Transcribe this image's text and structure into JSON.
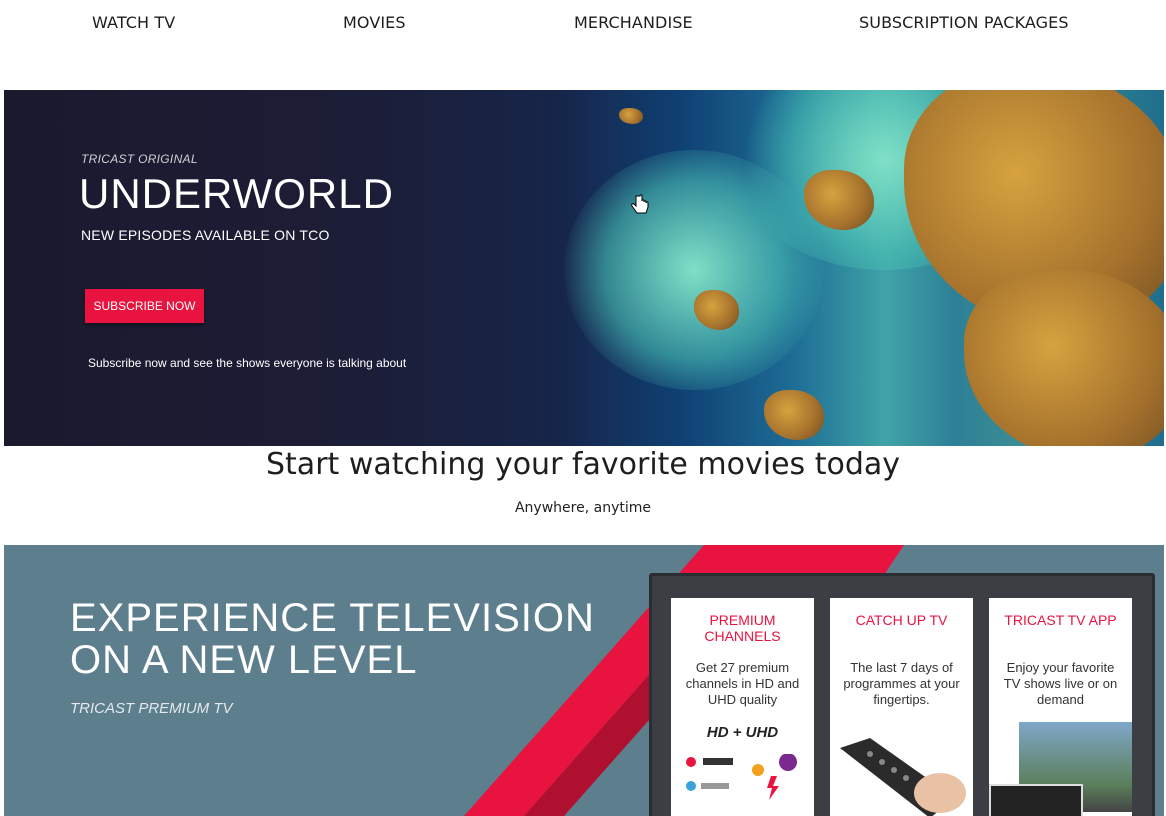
{
  "nav": {
    "items": [
      "WATCH TV",
      "MOVIES",
      "MERCHANDISE",
      "SUBSCRIPTION PACKAGES"
    ]
  },
  "hero": {
    "eyebrow": "TRICAST ORIGINAL",
    "title": "UNDERWORLD",
    "subtitle": "NEW EPISODES AVAILABLE ON TCO",
    "button_label": "SUBSCRIBE NOW",
    "tagline": "Subscribe now and see the shows everyone is talking about"
  },
  "main": {
    "headline": "Start watching your favorite movies today",
    "tagline": "Anywhere, anytime"
  },
  "banner": {
    "title_line1": "EXPERIENCE TELEVISION",
    "title_line2": "ON A NEW LEVEL",
    "subtitle": "TRICAST PREMIUM TV",
    "cards": [
      {
        "title": "PREMIUM CHANNELS",
        "body": "Get 27 premium channels in HD and UHD quality",
        "badge": "HD + UHD"
      },
      {
        "title": "CATCH UP TV",
        "body": "The last 7 days of programmes at your fingertips."
      },
      {
        "title": "TRICAST TV APP",
        "body": "Enjoy your favorite TV shows live or on demand"
      }
    ]
  },
  "colors": {
    "accent": "#e8133f",
    "banner_bg": "#5d7e8c"
  }
}
